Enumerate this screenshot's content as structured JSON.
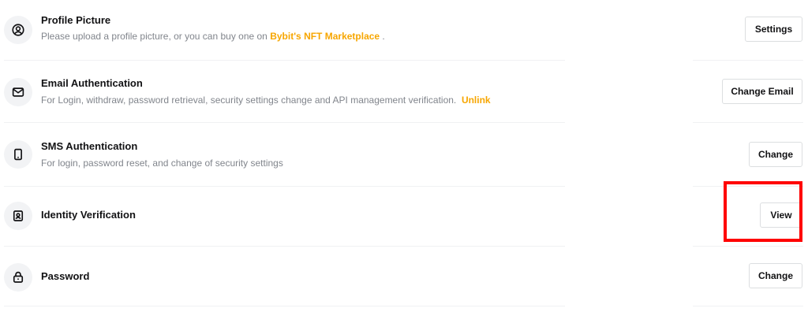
{
  "rows": [
    {
      "title": "Profile Picture",
      "desc_prefix": "Please upload a profile picture, or you can buy one on ",
      "desc_link": "Bybit's NFT Marketplace",
      "desc_suffix": " .",
      "button": "Settings",
      "icon": "user-circle-icon"
    },
    {
      "title": "Email Authentication",
      "desc_prefix": "For Login, withdraw, password retrieval, security settings change and API management verification.",
      "desc_link": "Unlink",
      "button": "Change Email",
      "icon": "envelope-icon"
    },
    {
      "title": "SMS Authentication",
      "desc_prefix": "For login, password reset, and change of security settings",
      "button": "Change",
      "icon": "phone-icon"
    },
    {
      "title": "Identity Verification",
      "button": "View",
      "icon": "id-badge-icon"
    },
    {
      "title": "Password",
      "button": "Change",
      "icon": "lock-icon"
    }
  ],
  "colors": {
    "accent": "#f7a600",
    "highlight": "#ff0000",
    "muted_text": "#81858c",
    "icon_bg": "#f2f3f5"
  }
}
